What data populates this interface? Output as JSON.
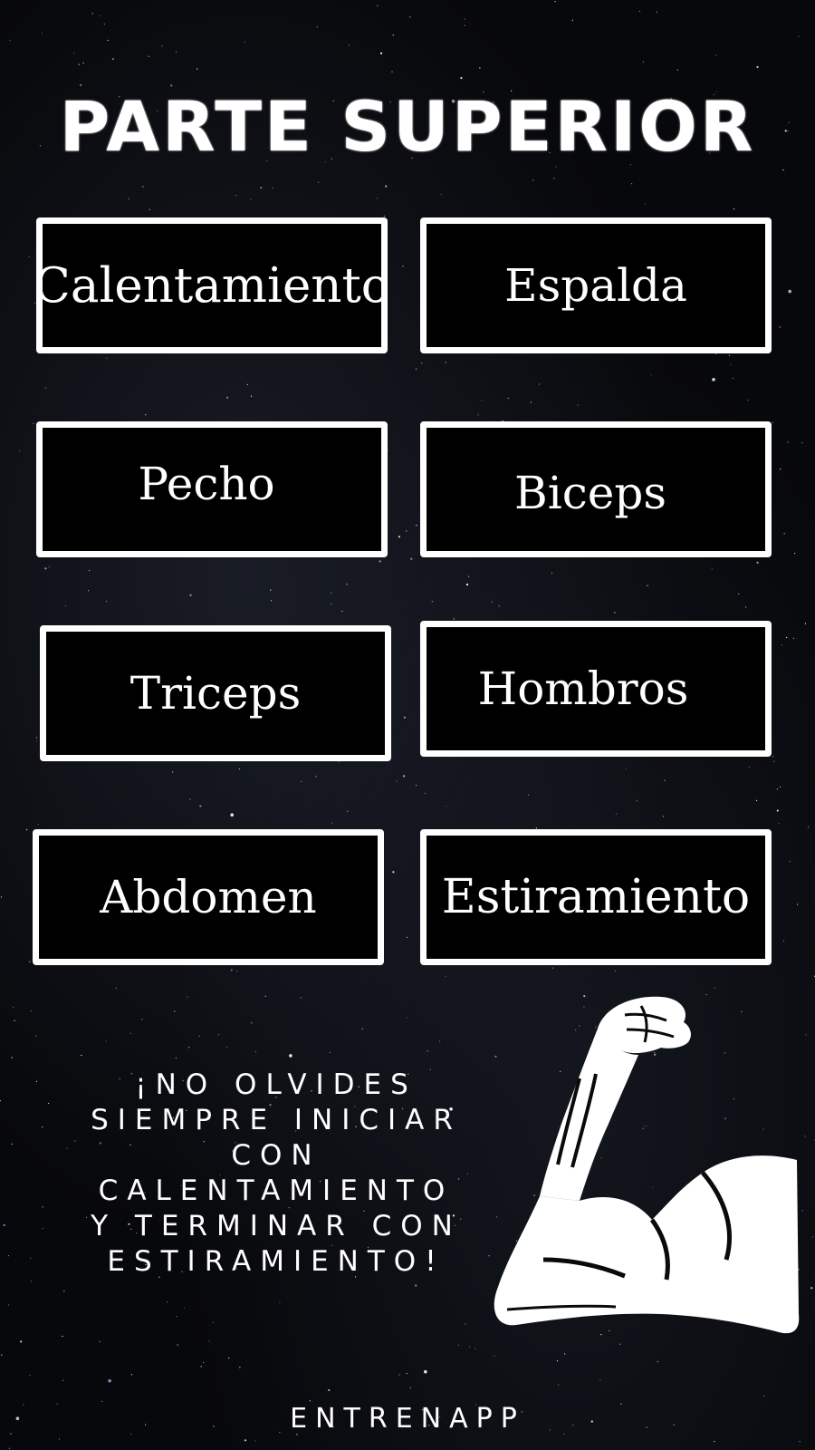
{
  "screen": {
    "title": "PARTE SUPERIOR",
    "background": "starry-night-sky"
  },
  "menu": {
    "items": [
      {
        "label": "Calentamiento"
      },
      {
        "label": "Espalda"
      },
      {
        "label": "Pecho"
      },
      {
        "label": "Biceps"
      },
      {
        "label": "Triceps"
      },
      {
        "label": "Hombros"
      },
      {
        "label": "Abdomen"
      },
      {
        "label": "Estiramiento"
      }
    ]
  },
  "reminder": {
    "lines": [
      "¡NO OLVIDES",
      "SIEMPRE INICIAR",
      "CON",
      "CALENTAMIENTO",
      "Y TERMINAR CON",
      "ESTIRAMIENTO!"
    ]
  },
  "illustration": {
    "icon": "flexed-arm-icon"
  },
  "footer": {
    "brand": "ENTRENAPP"
  },
  "colors": {
    "background": "#07080b",
    "button_fill": "#000000",
    "button_border": "#ffffff",
    "text": "#ffffff"
  }
}
